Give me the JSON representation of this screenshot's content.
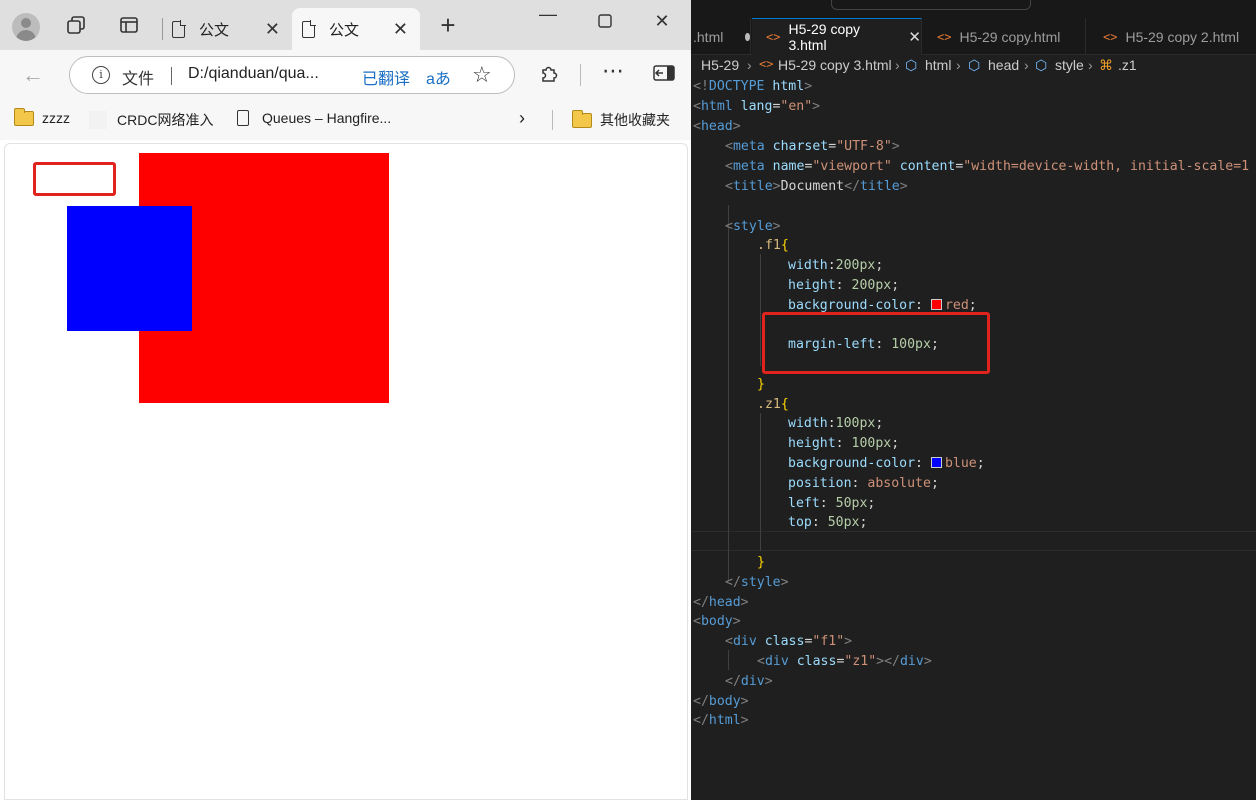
{
  "browser": {
    "tabs": [
      {
        "label": "公文"
      },
      {
        "label": "公文"
      }
    ],
    "address": {
      "protocol_label": "文件",
      "url": "D:/qianduan/qua...",
      "translate_label": "已翻译",
      "translate_icon_text": "aあ"
    },
    "bookmarks": [
      {
        "label": "zzzz"
      },
      {
        "label": "CRDC网络准入"
      },
      {
        "label": "Queues – Hangfire..."
      },
      {
        "label": "其他收藏夹"
      }
    ],
    "page": {
      "parent_color": "#ff0000",
      "child_color": "#0000ff"
    }
  },
  "editor": {
    "tabs": [
      {
        "label": ".html"
      },
      {
        "label": "H5-29 copy 3.html"
      },
      {
        "label": "H5-29 copy.html"
      },
      {
        "label": "H5-29 copy 2.html"
      }
    ],
    "breadcrumb": [
      "H5-29",
      "H5-29 copy 3.html",
      "html",
      "head",
      "style",
      ".z1"
    ],
    "code": {
      "l1_a": "<!",
      "l1_b": "DOCTYPE",
      "l1_c": "html",
      "l1_d": ">",
      "l2_tag": "html",
      "l2_attr": "lang",
      "l2_val": "\"en\"",
      "l3_tag": "head",
      "l4_tag": "meta",
      "l4_attr": "charset",
      "l4_val": "\"UTF-8\"",
      "l5_tag": "meta",
      "l5_attr1": "name",
      "l5_val1": "\"viewport\"",
      "l5_attr2": "content",
      "l5_val2": "\"width=device-width, initial-scale=1",
      "l6_tag": "title",
      "l6_text": "Document",
      "l8_tag": "style",
      "sel_f1": ".f1",
      "f1_width_prop": "width",
      "f1_width_val": "200px",
      "f1_height_prop": "height",
      "f1_height_val": "200px",
      "f1_bg_prop": "background-color",
      "f1_bg_val": "red",
      "f1_ml_prop": "margin-left",
      "f1_ml_val": "100px",
      "sel_z1": ".z1",
      "z1_width_prop": "width",
      "z1_width_val": "100px",
      "z1_height_prop": "height",
      "z1_height_val": "100px",
      "z1_bg_prop": "background-color",
      "z1_bg_val": "blue",
      "z1_pos_prop": "position",
      "z1_pos_val": "absolute",
      "z1_left_prop": "left",
      "z1_left_val": "50px",
      "z1_top_prop": "top",
      "z1_top_val": "50px",
      "body_tag": "body",
      "div_tag": "div",
      "class_attr": "class",
      "f1_class": "\"f1\"",
      "z1_class": "\"z1\""
    }
  }
}
